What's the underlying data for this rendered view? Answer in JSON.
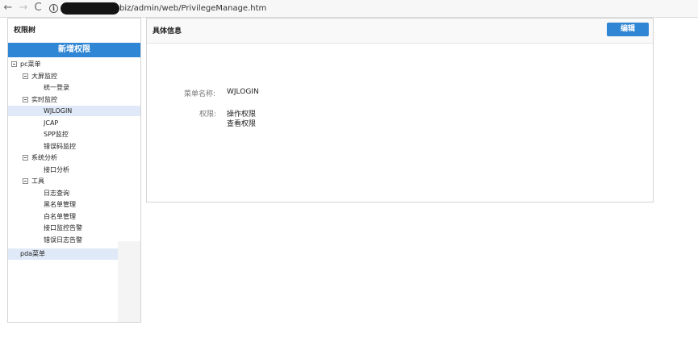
{
  "browser": {
    "url_visible": "biz/admin/web/PrivilegeManage.htm",
    "back_glyph": "←",
    "forward_glyph": "→",
    "reload_glyph": "C",
    "info_glyph": "i"
  },
  "sidebar": {
    "title": "权限树",
    "add_button": "新增权限",
    "tree": [
      {
        "label": "pc菜单",
        "level": 0,
        "toggle": true,
        "selected": false
      },
      {
        "label": "大屏监控",
        "level": 1,
        "toggle": true,
        "selected": false
      },
      {
        "label": "统一登录",
        "level": 2,
        "toggle": false,
        "selected": false
      },
      {
        "label": "实时监控",
        "level": 1,
        "toggle": true,
        "selected": false
      },
      {
        "label": "WJLOGIN",
        "level": 2,
        "toggle": false,
        "selected": true
      },
      {
        "label": "JCAP",
        "level": 2,
        "toggle": false,
        "selected": false
      },
      {
        "label": "SPP监控",
        "level": 2,
        "toggle": false,
        "selected": false
      },
      {
        "label": "错误码监控",
        "level": 2,
        "toggle": false,
        "selected": false
      },
      {
        "label": "系统分析",
        "level": 1,
        "toggle": true,
        "selected": false
      },
      {
        "label": "接口分析",
        "level": 2,
        "toggle": false,
        "selected": false
      },
      {
        "label": "工具",
        "level": 1,
        "toggle": true,
        "selected": false
      },
      {
        "label": "日志查询",
        "level": 2,
        "toggle": false,
        "selected": false
      },
      {
        "label": "黑名单管理",
        "level": 2,
        "toggle": false,
        "selected": false
      },
      {
        "label": "白名单管理",
        "level": 2,
        "toggle": false,
        "selected": false
      },
      {
        "label": "接口监控告警",
        "level": 2,
        "toggle": false,
        "selected": false
      },
      {
        "label": "错误日志告警",
        "level": 2,
        "toggle": false,
        "selected": false
      }
    ],
    "pda_menu": "pda菜单"
  },
  "detail": {
    "title": "具体信息",
    "edit_button": "编辑",
    "menu_name_label": "菜单名称:",
    "menu_name_value": "WJLOGIN",
    "privilege_label": "权限:",
    "privileges": [
      "操作权限",
      "查看权限"
    ]
  },
  "colors": {
    "accent": "#2f86d4",
    "selected_row": "#dfe9f7",
    "border": "#d4d4d4"
  }
}
